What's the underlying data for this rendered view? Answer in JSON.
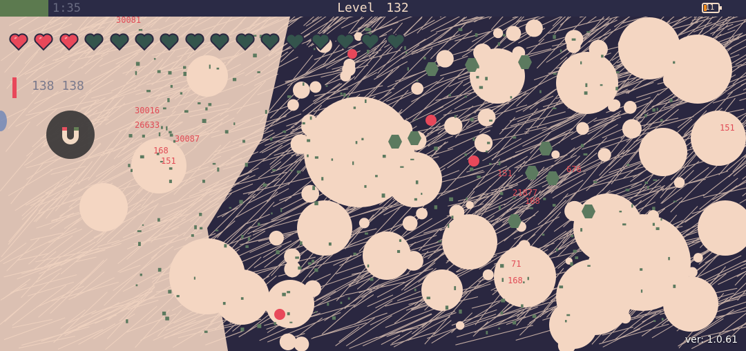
{
  "hud": {
    "timer": "1:35",
    "level_label": "Level",
    "level_value": "132",
    "battery_level": "11",
    "xp_progress": 0.065
  },
  "hearts": [
    "full",
    "full",
    "full",
    "empty",
    "empty",
    "empty",
    "empty",
    "empty",
    "empty",
    "empty",
    "empty",
    "empty",
    "empty",
    "empty",
    "empty",
    "empty"
  ],
  "hp": {
    "current": "138",
    "max": "138",
    "fill_fraction": 1.0
  },
  "damage_numbers": [
    "30081",
    "30016",
    "26633",
    "30087",
    "168",
    "151",
    "151",
    "21877",
    "168",
    "71",
    "168",
    "676",
    "151"
  ],
  "version": "ver: 1.0.61",
  "colors": {
    "background_dark": "#2a2740",
    "bullet_trail": "#f4d6c2",
    "enemy_green": "#5c7a5f",
    "heart_full": "#e8485a",
    "heart_empty": "#34544c",
    "damage_text": "#e14a55",
    "hud_bar": "#2b2b46",
    "xp_fill": "#5c7a4f",
    "battery_accent": "#f08a1c"
  },
  "icons": {
    "magnet_button": "magnet-icon",
    "heart": "heart-icon"
  }
}
